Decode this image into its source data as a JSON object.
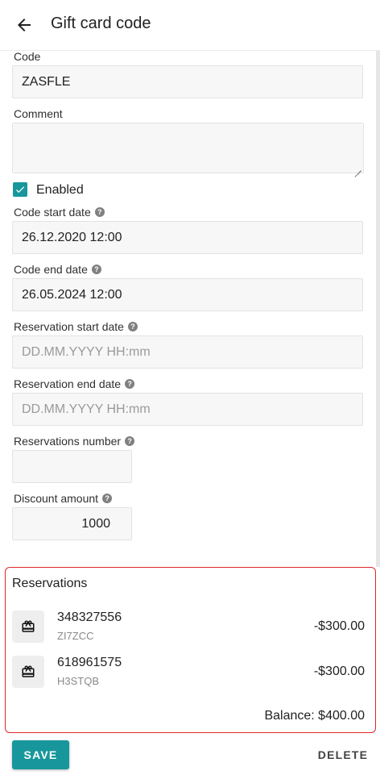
{
  "header": {
    "title": "Gift card code",
    "back_icon": "arrow-left-icon"
  },
  "form": {
    "code": {
      "label": "Code",
      "value": "ZASFLE"
    },
    "comment": {
      "label": "Comment",
      "value": ""
    },
    "enabled": {
      "label": "Enabled",
      "checked": true
    },
    "code_start": {
      "label": "Code start date",
      "value": "26.12.2020 12:00"
    },
    "code_end": {
      "label": "Code end date",
      "value": "26.05.2024 12:00"
    },
    "reservation_start": {
      "label": "Reservation start date",
      "placeholder": "DD.MM.YYYY HH:mm"
    },
    "reservation_end": {
      "label": "Reservation end date",
      "placeholder": "DD.MM.YYYY HH:mm"
    },
    "reservations_number": {
      "label": "Reservations number",
      "value": ""
    },
    "discount_amount": {
      "label": "Discount amount",
      "value": "1000"
    }
  },
  "reservations": {
    "title": "Reservations",
    "items": [
      {
        "number": "348327556",
        "code": "ZI7ZCC",
        "amount": "-$300.00"
      },
      {
        "number": "618961575",
        "code": "H3STQB",
        "amount": "-$300.00"
      }
    ],
    "balance": "Balance: $400.00"
  },
  "actions": {
    "save": "SAVE",
    "delete": "DELETE"
  },
  "colors": {
    "accent": "#17979c",
    "highlight_border": "#e0272a"
  }
}
